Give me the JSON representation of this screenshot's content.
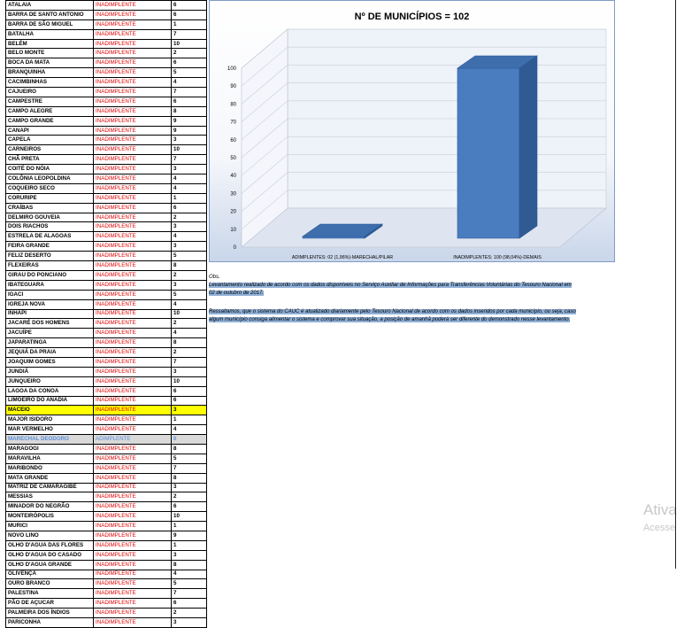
{
  "table": {
    "rows": [
      {
        "name": "ATALAIA",
        "status": "INADIMPLENTE",
        "n": "6"
      },
      {
        "name": "BARRA DE SANTO ANTONIO",
        "status": "INADIMPLENTE",
        "n": "6"
      },
      {
        "name": "BARRA DE SÃO MIGUEL",
        "status": "INADIMPLENTE",
        "n": "1"
      },
      {
        "name": "BATALHA",
        "status": "INADIMPLENTE",
        "n": "7"
      },
      {
        "name": "BELÉM",
        "status": "INADIMPLENTE",
        "n": "10"
      },
      {
        "name": "BELO MONTE",
        "status": "INADIMPLENTE",
        "n": "2"
      },
      {
        "name": "BOCA DA MATA",
        "status": "INADIMPLENTE",
        "n": "6"
      },
      {
        "name": "BRANQUINHA",
        "status": "INADIMPLENTE",
        "n": "5"
      },
      {
        "name": "CACIMBINHAS",
        "status": "INADIMPLENTE",
        "n": "4"
      },
      {
        "name": "CAJUEIRO",
        "status": "INADIMPLENTE",
        "n": "7"
      },
      {
        "name": "CAMPESTRE",
        "status": "INADIMPLENTE",
        "n": "6"
      },
      {
        "name": "CAMPO ALEGRE",
        "status": "INADIMPLENTE",
        "n": "8"
      },
      {
        "name": "CAMPO GRANDE",
        "status": "INADIMPLENTE",
        "n": "9"
      },
      {
        "name": "CANAPI",
        "status": "INADIMPLENTE",
        "n": "9"
      },
      {
        "name": "CAPELA",
        "status": "INADIMPLENTE",
        "n": "3"
      },
      {
        "name": "CARNEIROS",
        "status": "INADIMPLENTE",
        "n": "10"
      },
      {
        "name": "CHÃ PRETA",
        "status": "INADIMPLENTE",
        "n": "7"
      },
      {
        "name": "COITÉ DO NÓIA",
        "status": "INADIMPLENTE",
        "n": "3"
      },
      {
        "name": "COLÔNIA LEOPOLDINA",
        "status": "INADIMPLENTE",
        "n": "4"
      },
      {
        "name": "COQUEIRO SECO",
        "status": "INADIMPLENTE",
        "n": "4"
      },
      {
        "name": "CORURIPE",
        "status": "INADIMPLENTE",
        "n": "1"
      },
      {
        "name": "CRAÍBAS",
        "status": "INADIMPLENTE",
        "n": "6"
      },
      {
        "name": "DELMIRO GOUVEIA",
        "status": "INADIMPLENTE",
        "n": "2"
      },
      {
        "name": "DOIS RIACHOS",
        "status": "INADIMPLENTE",
        "n": "3"
      },
      {
        "name": "ESTRELA DE ALAGOAS",
        "status": "INADIMPLENTE",
        "n": "4"
      },
      {
        "name": "FEIRA GRANDE",
        "status": "INADIMPLENTE",
        "n": "3"
      },
      {
        "name": "FELIZ DESERTO",
        "status": "INADIMPLENTE",
        "n": "5"
      },
      {
        "name": "FLEXEIRAS",
        "status": "INADIMPLENTE",
        "n": "8"
      },
      {
        "name": "GIRAU DO PONCIANO",
        "status": "INADIMPLENTE",
        "n": "2"
      },
      {
        "name": "IBATEGUARA",
        "status": "INADIMPLENTE",
        "n": "3"
      },
      {
        "name": "IGACI",
        "status": "INADIMPLENTE",
        "n": "5"
      },
      {
        "name": "IGREJA NOVA",
        "status": "INADIMPLENTE",
        "n": "4"
      },
      {
        "name": "INHAPI",
        "status": "INADIMPLENTE",
        "n": "10"
      },
      {
        "name": "JACARÉ DOS HOMENS",
        "status": "INADIMPLENTE",
        "n": "2"
      },
      {
        "name": "JACUÍPE",
        "status": "INADIMPLENTE",
        "n": "4"
      },
      {
        "name": "JAPARATINGA",
        "status": "INADIMPLENTE",
        "n": "8"
      },
      {
        "name": "JEQUIÁ DA PRAIA",
        "status": "INADIMPLENTE",
        "n": "2"
      },
      {
        "name": "JOAQUIM GOMES",
        "status": "INADIMPLENTE",
        "n": "7"
      },
      {
        "name": "JUNDIÁ",
        "status": "INADIMPLENTE",
        "n": "3"
      },
      {
        "name": "JUNQUEIRO",
        "status": "INADIMPLENTE",
        "n": "10"
      },
      {
        "name": "LAGOA DA CONOA",
        "status": "INADIMPLENTE",
        "n": "6"
      },
      {
        "name": "LIMOEIRO DO ANADIA",
        "status": "INADIMPLENTE",
        "n": "6"
      },
      {
        "name": "MACEIO",
        "status": "INADIMPLENTE",
        "n": "3",
        "highlight": "yellow"
      },
      {
        "name": "MAJOR ISIDORO",
        "status": "INADIMPLENTE",
        "n": "1"
      },
      {
        "name": "MAR VERMELHO",
        "status": "INADIMPLENTE",
        "n": "4"
      },
      {
        "name": "MARECHAL DEODORO",
        "status": "ADIMPLENTE",
        "n": "0",
        "highlight": "gray"
      },
      {
        "name": "MARAGOGI",
        "status": "INADIMPLENTE",
        "n": "8"
      },
      {
        "name": "MARAVILHA",
        "status": "INADIMPLENTE",
        "n": "5"
      },
      {
        "name": "MARIBONDO",
        "status": "INADIMPLENTE",
        "n": "7"
      },
      {
        "name": "MATA GRANDE",
        "status": "INADIMPLENTE",
        "n": "8"
      },
      {
        "name": "MATRIZ DE CAMARAGIBE",
        "status": "INADIMPLENTE",
        "n": "3"
      },
      {
        "name": "MESSIAS",
        "status": "INADIMPLENTE",
        "n": "2"
      },
      {
        "name": "MINADOR DO NEGRÃO",
        "status": "INADIMPLENTE",
        "n": "6"
      },
      {
        "name": "MONTEIRÓPOLIS",
        "status": "INADIMPLENTE",
        "n": "10"
      },
      {
        "name": "MURICI",
        "status": "INADIMPLENTE",
        "n": "1"
      },
      {
        "name": "NOVO LINO",
        "status": "INADIMPLENTE",
        "n": "9"
      },
      {
        "name": "OLHO D'AGUA DAS FLORES",
        "status": "INADIMPLENTE",
        "n": "1"
      },
      {
        "name": "OLHO D'AGUA DO CASADO",
        "status": "INADIMPLENTE",
        "n": "3"
      },
      {
        "name": "OLHO D'AGUA GRANDE",
        "status": "INADIMPLENTE",
        "n": "8"
      },
      {
        "name": "OLIVENÇA",
        "status": "INADIMPLENTE",
        "n": "4"
      },
      {
        "name": "OURO BRANCO",
        "status": "INADIMPLENTE",
        "n": "5"
      },
      {
        "name": "PALESTINA",
        "status": "INADIMPLENTE",
        "n": "7"
      },
      {
        "name": "PÃO DE AÇUCAR",
        "status": "INADIMPLENTE",
        "n": "6"
      },
      {
        "name": "PALMEIRA DOS ÍNDIOS",
        "status": "INADIMPLENTE",
        "n": "2"
      },
      {
        "name": "PARICONHA",
        "status": "INADIMPLENTE",
        "n": "3"
      }
    ]
  },
  "chart_data": {
    "type": "bar",
    "title": "Nº DE MUNICÍPIOS = 102",
    "categories": [
      "ADIMPLENTES: 02 (1,96%)-MARECHAL/PILAR",
      "INADIMPLENTES: 100 (98,04%)-DEMAIS"
    ],
    "values": [
      2,
      100
    ],
    "ylim": [
      0,
      100
    ],
    "yticks": [
      "0",
      "10",
      "20",
      "30",
      "40",
      "50",
      "60",
      "70",
      "80",
      "90",
      "100"
    ],
    "grid": true,
    "bar_color": "#4a7cc0"
  },
  "notes": {
    "obs_label": "Obs.",
    "line1": "Levantamento realizado de acordo com os dados disponíveis no Serviço Auxiliar de Informações para Transferências Voluntárias do Tesouro Nacional em",
    "line2": "02 de outubro de 2017.",
    "line3": "Ressaltamos, que o sistema do CAUC é atualizado diariamente  pelo Tesouro Nacional de acordo com os dados inseridos por cada município, ou seja, caso",
    "line4": "algum município consiga alimentar o sistema e comprovar sua situação, a posição de amanhã poderá ser diferente do demonstrado nesse levantamento."
  },
  "watermark": {
    "line1": "Ativa",
    "line2": "Acesse"
  }
}
